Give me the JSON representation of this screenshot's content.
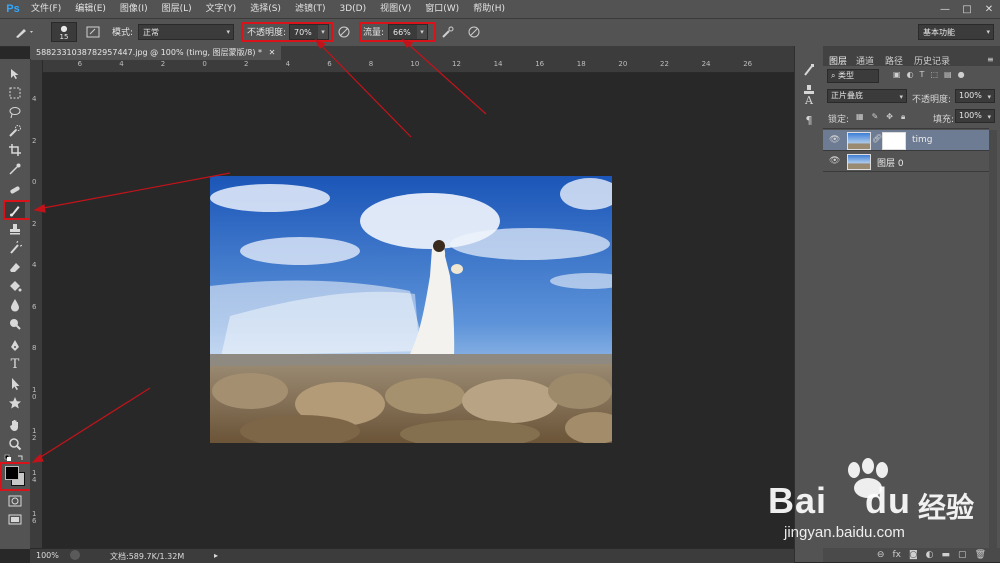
{
  "app": {
    "logo": "Ps"
  },
  "menu": [
    "文件(F)",
    "编辑(E)",
    "图像(I)",
    "图层(L)",
    "文字(Y)",
    "选择(S)",
    "滤镜(T)",
    "3D(D)",
    "视图(V)",
    "窗口(W)",
    "帮助(H)"
  ],
  "window_controls": {
    "minimize": "—",
    "maximize": "□",
    "close": "✕"
  },
  "options": {
    "brush_size": "15",
    "mode_label": "模式:",
    "mode_value": "正常",
    "opacity_label": "不透明度:",
    "opacity_value": "70%",
    "flow_label": "流量:",
    "flow_value": "66%",
    "workspace": "基本功能"
  },
  "document": {
    "tab_title": "588233103878295744​7.jpg @ 100% (timg, 图层蒙版/8) *",
    "zoom": "100%",
    "doc_size": "文档:589.7K/1.32M"
  },
  "ruler_top": [
    "8",
    "6",
    "4",
    "2",
    "0",
    "2",
    "4",
    "6",
    "8",
    "10",
    "12",
    "14",
    "16",
    "18",
    "20",
    "22",
    "24",
    "26"
  ],
  "ruler_left": [
    "4",
    "2",
    "0",
    "2",
    "4",
    "6",
    "8",
    "1\n0",
    "1\n2",
    "1\n4",
    "1\n6"
  ],
  "layers_panel": {
    "tabs": [
      "图层",
      "通道",
      "路径",
      "历史记录"
    ],
    "filter": "类型",
    "blend_mode": "正片叠底",
    "opacity_label": "不透明度:",
    "opacity_value": "100%",
    "lock_label": "锁定:",
    "fill_label": "填充:",
    "fill_value": "100%",
    "layers": [
      {
        "name": "timg",
        "selected": true
      },
      {
        "name": "图层 0",
        "selected": false
      }
    ]
  },
  "watermark": {
    "brand": "Bai",
    "brand2": "du",
    "cn": "经验",
    "url": "jingyan.baidu.com"
  },
  "colors": {
    "accent_red": "#d8131a",
    "ps_blue": "#31a8ff"
  }
}
